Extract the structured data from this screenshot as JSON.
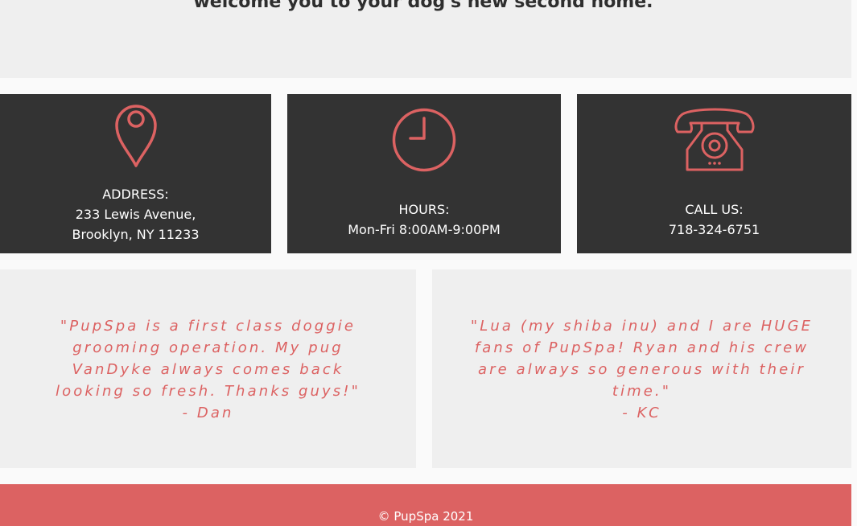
{
  "hero": {
    "heading": "welcome you to your dog's new second home."
  },
  "info": {
    "address": {
      "icon": "map-pin-icon",
      "label": "ADDRESS:",
      "line1": "233 Lewis Avenue,",
      "line2": "Brooklyn, NY 11233"
    },
    "hours": {
      "icon": "clock-icon",
      "label": "HOURS:",
      "value": "Mon-Fri 8:00AM-9:00PM"
    },
    "phone": {
      "icon": "phone-icon",
      "label": "CALL US:",
      "value": "718-324-6751"
    }
  },
  "testimonials": [
    {
      "quote": "\"PupSpa is a first class doggie grooming operation. My pug VanDyke always comes back looking so fresh. Thanks guys!\"",
      "author": "- Dan"
    },
    {
      "quote": "\"Lua (my shiba inu) and I are HUGE fans of PupSpa! Ryan and his crew are always so generous with their time.\"",
      "author": "- KC"
    }
  ],
  "footer": {
    "copyright": "© PupSpa 2021"
  },
  "colors": {
    "accent": "#dc6262",
    "dark_panel": "#333333",
    "light_panel": "#efefef",
    "page_background": "#fafafa"
  }
}
